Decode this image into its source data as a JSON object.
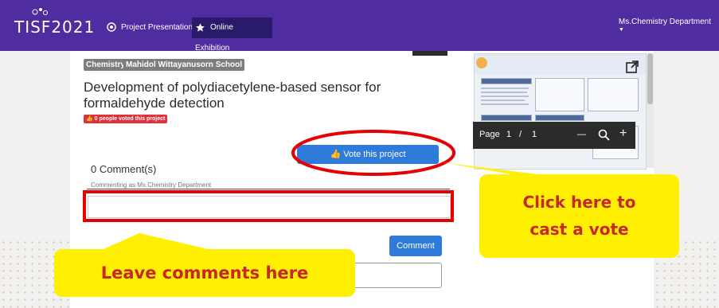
{
  "nav": {
    "logo_text": "TISF2021",
    "items": [
      {
        "label": "Project Presentation",
        "icon": "target-icon"
      },
      {
        "label": "Online Exhibition",
        "icon": "star-icon"
      }
    ],
    "user": "Ms.Chemistry Department"
  },
  "project": {
    "tags": [
      "Chemistry",
      "Mahidol Wittayanusorn School"
    ],
    "title": "Development of polydiacetylene-based sensor for formaldehyde detection",
    "votes_badge": "0 people voted this project",
    "vote_button": "Vote this project"
  },
  "comments": {
    "heading": "0 Comment(s)",
    "commenting_as": "Commenting as Ms.Chemistry Department",
    "input_value": "",
    "submit_label": "Comment"
  },
  "viewer": {
    "page_label": "Page",
    "page_current": "1",
    "page_sep": "/",
    "page_total": "1",
    "zoom_out": "—",
    "zoom_in": "+"
  },
  "annotations": {
    "left_callout": "Leave comments here",
    "right_callout_line1": "Click here to",
    "right_callout_line2": "cast a vote",
    "highlight_color": "#e60000",
    "callout_bg": "#ffef00",
    "callout_text_color": "#c62828"
  },
  "colors": {
    "nav_bg": "#4f2ca0",
    "accent_blue": "#2e7bd9",
    "badge_red": "#e0303a"
  }
}
